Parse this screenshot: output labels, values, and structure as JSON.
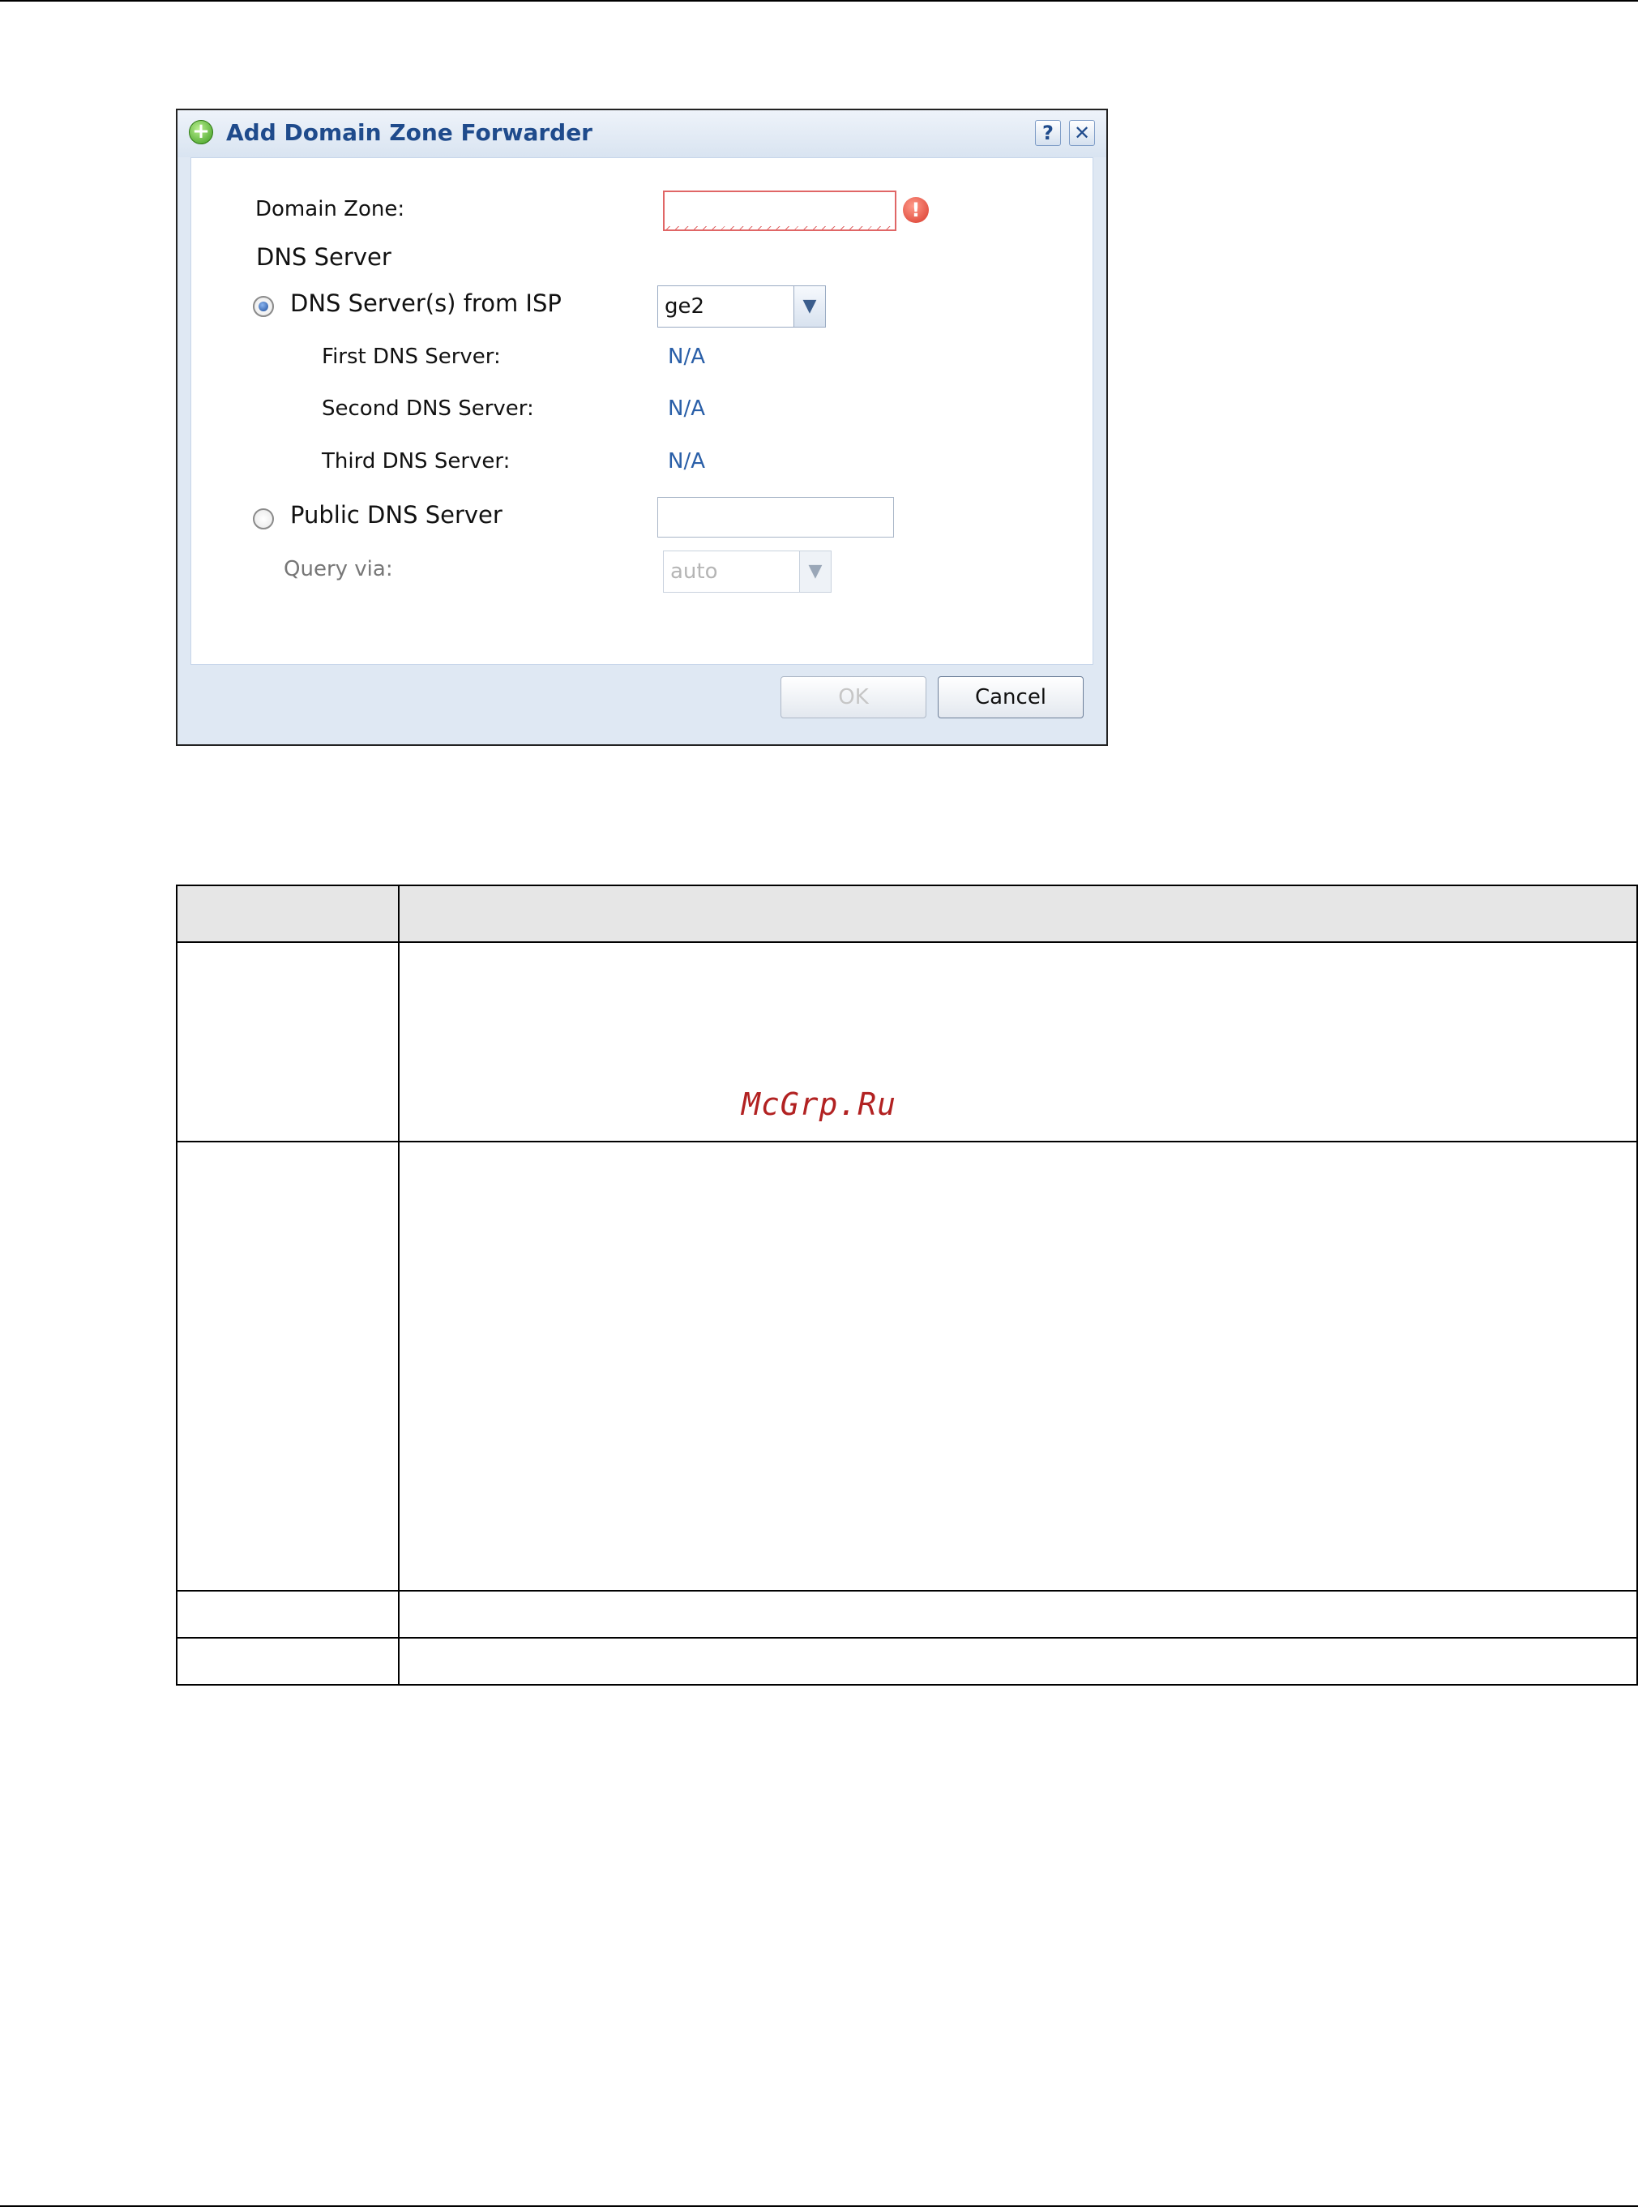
{
  "dialog": {
    "title": "Add Domain Zone Forwarder",
    "help_icon": "?",
    "close_icon": "✕",
    "domain_zone_label": "Domain Zone:",
    "domain_zone_value": "",
    "error_icon": "!",
    "dns_server_heading": "DNS Server",
    "isp_option": {
      "label": "DNS Server(s) from ISP",
      "selected": true,
      "interface_value": "ge2"
    },
    "first_dns": {
      "label": "First DNS Server:",
      "value": "N/A"
    },
    "second_dns": {
      "label": "Second DNS Server:",
      "value": "N/A"
    },
    "third_dns": {
      "label": "Third DNS Server:",
      "value": "N/A"
    },
    "public_option": {
      "label": "Public DNS Server",
      "selected": false,
      "value": ""
    },
    "query_via": {
      "label": "Query via:",
      "value": "auto"
    },
    "ok_label": "OK",
    "cancel_label": "Cancel"
  },
  "watermark": "McGrp.Ru"
}
